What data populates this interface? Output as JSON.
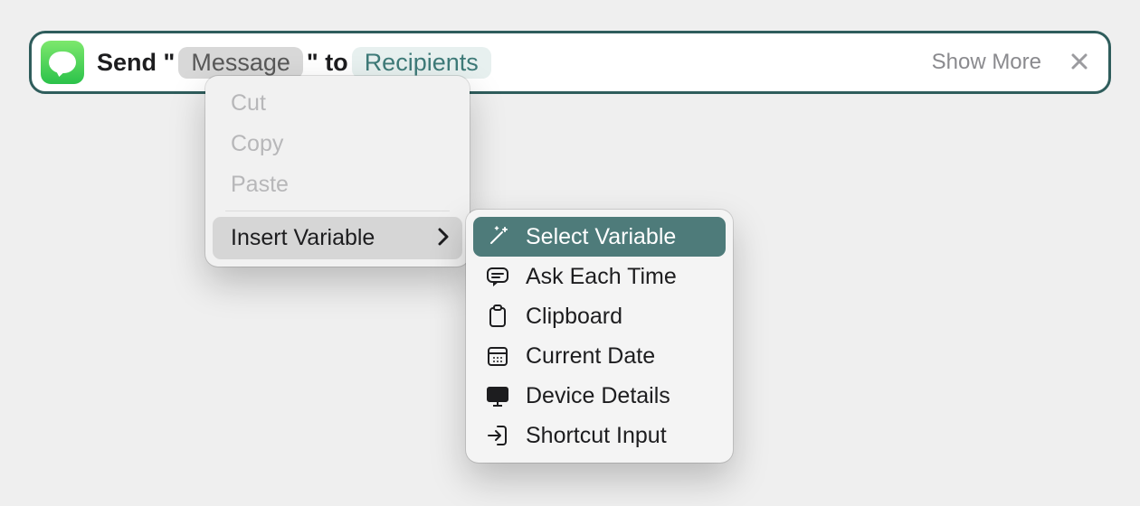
{
  "action": {
    "prefix": "Send \"",
    "message_token": "Message",
    "middle": "\" to",
    "recipients_token": "Recipients",
    "show_more": "Show More"
  },
  "context_menu": {
    "cut": "Cut",
    "copy": "Copy",
    "paste": "Paste",
    "insert_variable": "Insert Variable"
  },
  "variable_menu": {
    "select_variable": "Select Variable",
    "ask_each_time": "Ask Each Time",
    "clipboard": "Clipboard",
    "current_date": "Current Date",
    "device_details": "Device Details",
    "shortcut_input": "Shortcut Input"
  },
  "colors": {
    "teal_border": "#2f5d5c",
    "submenu_highlight": "#4e7b7a"
  }
}
